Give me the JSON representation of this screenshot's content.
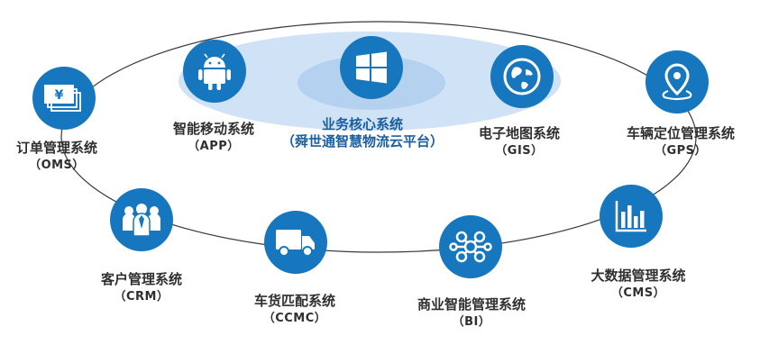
{
  "colors": {
    "primary": "#1677bf",
    "halo_outer": "#cfe2f6",
    "halo_inner": "#b4d2ef",
    "ring": "#3a3a3a"
  },
  "core": {
    "name": "业务核心系统",
    "sub": "（舜世通智慧物流云平台）",
    "icon": "windows-icon"
  },
  "systems": {
    "app": {
      "name": "智能移动系统",
      "sub": "（APP）",
      "icon": "android-icon"
    },
    "gis": {
      "name": "电子地图系统",
      "sub": "（GIS）",
      "icon": "globe-icon"
    },
    "gps": {
      "name": "车辆定位管理系统",
      "sub": "（GPS）",
      "icon": "location-pin-icon"
    },
    "oms": {
      "name": "订单管理系统",
      "sub": "（OMS）",
      "icon": "money-cards-icon"
    },
    "crm": {
      "name": "客户管理系统",
      "sub": "（CRM）",
      "icon": "customers-icon"
    },
    "ccmc": {
      "name": "车货匹配系统",
      "sub": "（CCMC）",
      "icon": "truck-icon"
    },
    "bi": {
      "name": "商业智能管理系统",
      "sub": "（BI）",
      "icon": "network-nodes-icon"
    },
    "cms": {
      "name": "大数据管理系统",
      "sub": "（CMS）",
      "icon": "bar-chart-icon"
    }
  }
}
